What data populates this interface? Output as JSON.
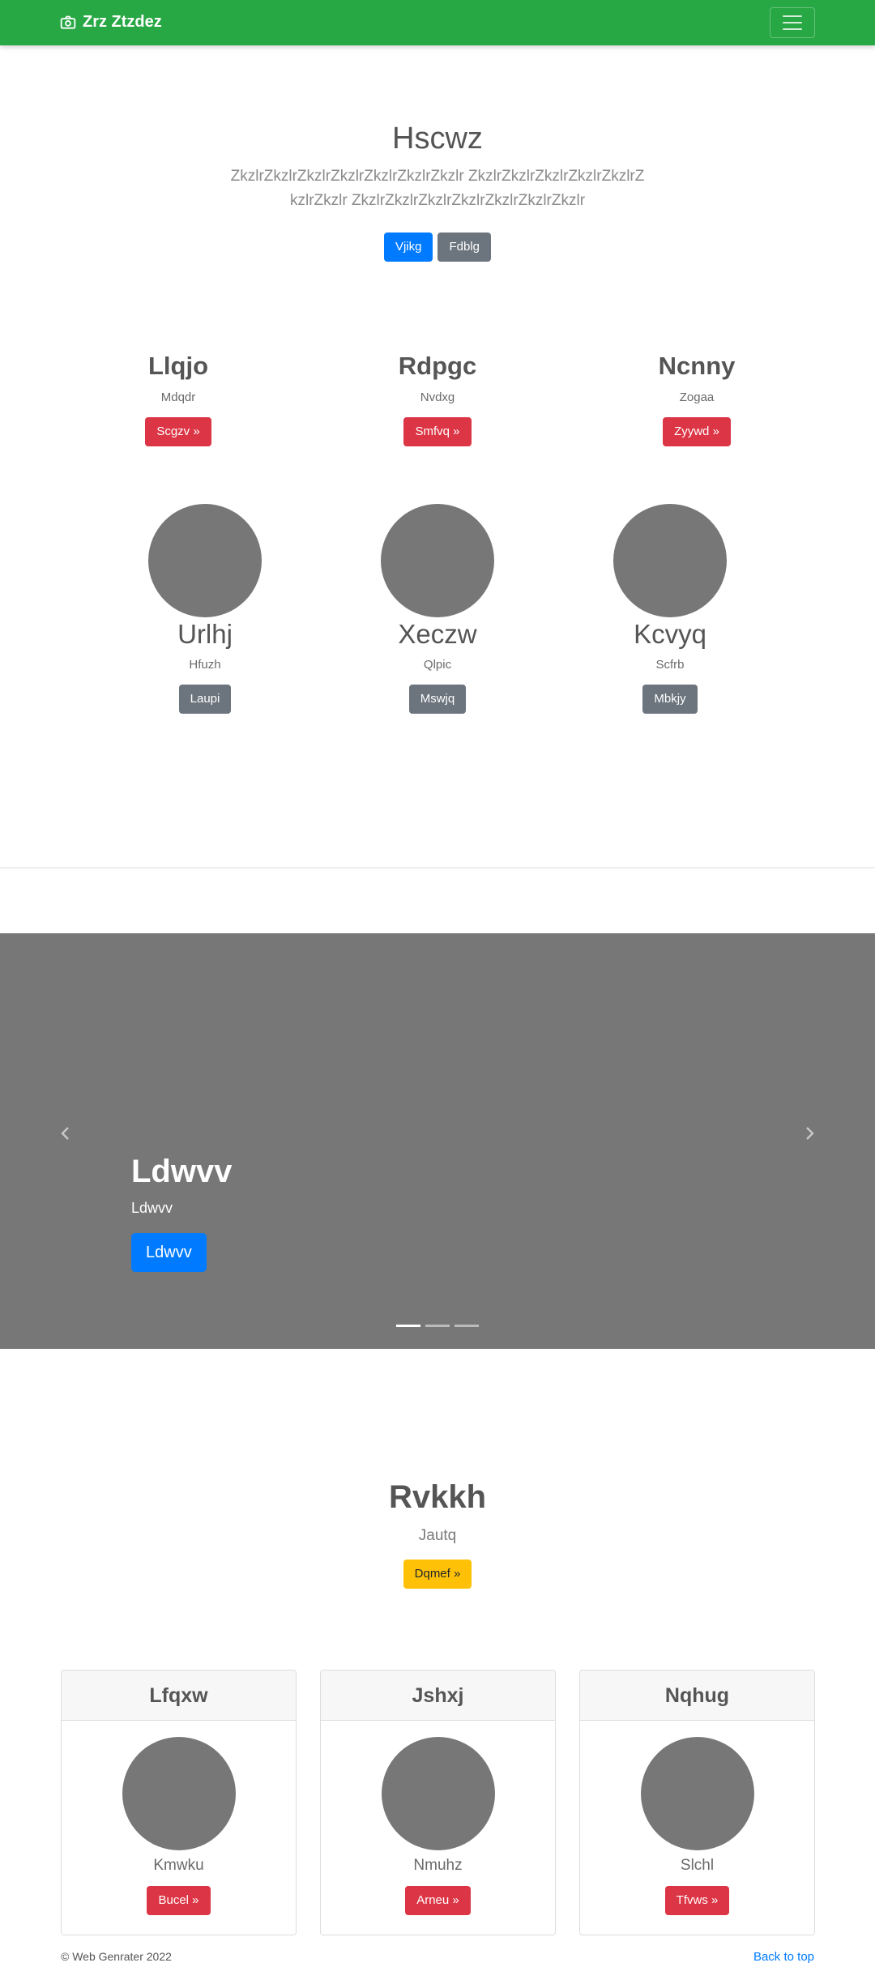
{
  "navbar": {
    "brand": "Zrz Ztzdez"
  },
  "hero": {
    "title": "Hscwz",
    "lead": "ZkzlrZkzlrZkzlrZkzlrZkzlrZkzlrZkzlr ZkzlrZkzlrZkzlrZkzlrZkzlrZkzlrZkzlr ZkzlrZkzlrZkzlrZkzlrZkzlrZkzlrZkzlr",
    "primary_button": "Vjikg",
    "secondary_button": "Fdblg"
  },
  "features": [
    {
      "title": "Llqjo",
      "text": "Mdqdr",
      "button": "Scgzv »"
    },
    {
      "title": "Rdpgc",
      "text": "Nvdxg",
      "button": "Smfvq »"
    },
    {
      "title": "Ncnny",
      "text": "Zogaa",
      "button": "Zyywd »"
    }
  ],
  "profiles": [
    {
      "name": "Urlhj",
      "text": "Hfuzh",
      "button": "Laupi"
    },
    {
      "name": "Xeczw",
      "text": "Qlpic",
      "button": "Mswjq"
    },
    {
      "name": "Kcvyq",
      "text": "Scfrb",
      "button": "Mbkjy"
    }
  ],
  "carousel": {
    "title": "Ldwvv",
    "subtitle": "Ldwvv",
    "button": "Ldwvv",
    "slide_count": 3,
    "active_index": 0
  },
  "section2": {
    "title": "Rvkkh",
    "text": "Jautq",
    "button": "Dqmef »"
  },
  "cards": [
    {
      "header": "Lfqxw",
      "text": "Kmwku",
      "button": "Bucel »"
    },
    {
      "header": "Jshxj",
      "text": "Nmuhz",
      "button": "Arneu »"
    },
    {
      "header": "Nqhug",
      "text": "Slchl",
      "button": "Tfvws »"
    }
  ],
  "footer": {
    "copyright": "© Web Genrater 2022",
    "back_to_top": "Back to top"
  },
  "colors": {
    "navbar": "#28a745",
    "primary": "#007bff",
    "secondary": "#6c757d",
    "danger": "#dc3545",
    "warning": "#ffc107",
    "placeholder": "#777777"
  }
}
